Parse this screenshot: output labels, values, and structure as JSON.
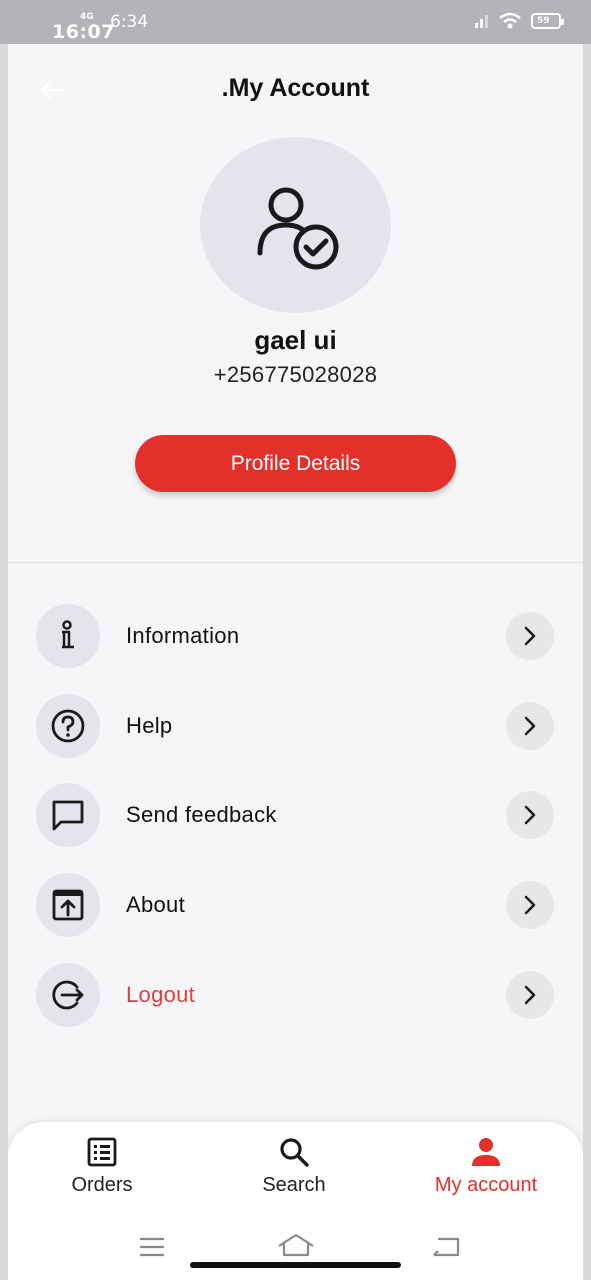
{
  "status_bar": {
    "time_overlay": "16:07",
    "network": "4G",
    "time": "6:34",
    "battery": "59"
  },
  "header": {
    "title": ".My Account",
    "back_icon": "arrow-left-icon"
  },
  "profile": {
    "avatar_icon": "user-check-icon",
    "name": "gael ui",
    "phone": "+256775028028",
    "details_button": "Profile Details"
  },
  "menu": {
    "items": [
      {
        "label": "Information",
        "icon": "info-icon"
      },
      {
        "label": "Help",
        "icon": "help-circle-icon"
      },
      {
        "label": "Send feedback",
        "icon": "chat-icon"
      },
      {
        "label": "About",
        "icon": "open-in-window-icon"
      },
      {
        "label": "Logout",
        "icon": "logout-icon"
      }
    ]
  },
  "bottom_nav": {
    "items": [
      {
        "label": "Orders",
        "icon": "list-icon"
      },
      {
        "label": "Search",
        "icon": "search-icon"
      },
      {
        "label": "My account",
        "icon": "person-icon",
        "active": true
      }
    ]
  },
  "colors": {
    "accent": "#e3302b",
    "logout": "#e04040",
    "icon_bg": "#e4e4ec"
  }
}
